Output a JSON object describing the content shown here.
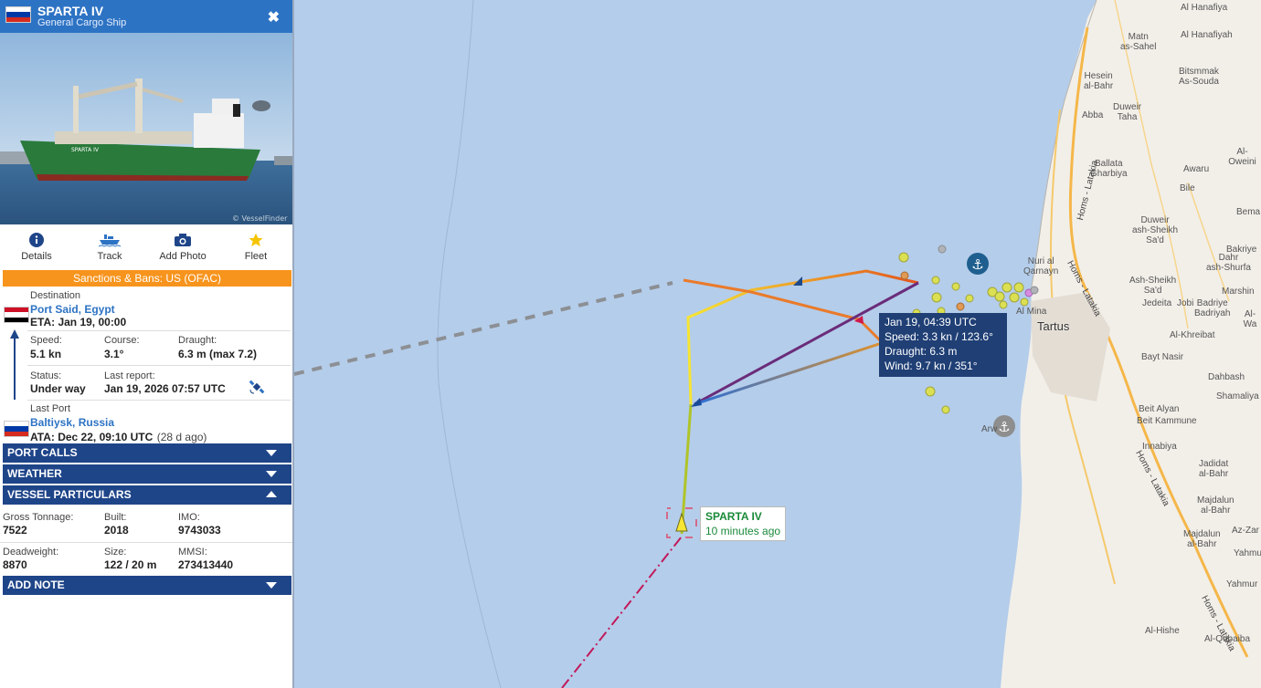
{
  "vessel": {
    "name": "SPARTA IV",
    "type": "General Cargo Ship",
    "flag_colors": [
      "#ffffff",
      "#0039a6",
      "#d52b1e"
    ]
  },
  "photo": {
    "watermark": "© VesselFinder"
  },
  "actions": [
    {
      "label": "Details",
      "icon": "info-icon"
    },
    {
      "label": "Track",
      "icon": "ship-icon"
    },
    {
      "label": "Add Photo",
      "icon": "camera-icon"
    },
    {
      "label": "Fleet",
      "icon": "star-icon"
    }
  ],
  "sanctions": "Sanctions & Bans: US (OFAC)",
  "destination": {
    "label": "Destination",
    "port": "Port Said, Egypt",
    "eta": "ETA: Jan 19, 00:00",
    "flag_colors": [
      "#ce1126",
      "#ffffff",
      "#000000"
    ]
  },
  "voyage": {
    "speed_label": "Speed:",
    "speed": "5.1 kn",
    "course_label": "Course:",
    "course": "3.1°",
    "draught_label": "Draught:",
    "draught": "6.3 m (max 7.2)",
    "status_label": "Status:",
    "status": "Under way",
    "report_label": "Last report:",
    "report": "Jan 19, 2026 07:57 UTC"
  },
  "last_port": {
    "label": "Last Port",
    "port": "Baltiysk, Russia",
    "ata": "ATA: Dec 22, 09:10 UTC",
    "ago": "(28 d ago)"
  },
  "sections": {
    "port_calls": "PORT CALLS",
    "weather": "WEATHER",
    "particulars": "VESSEL PARTICULARS",
    "add_note": "ADD NOTE"
  },
  "particulars": {
    "gt_label": "Gross Tonnage:",
    "gt": "7522",
    "built_label": "Built:",
    "built": "2018",
    "imo_label": "IMO:",
    "imo": "9743033",
    "dwt_label": "Deadweight:",
    "dwt": "8870",
    "size_label": "Size:",
    "size": "122 / 20 m",
    "mmsi_label": "MMSI:",
    "mmsi": "273413440"
  },
  "tooltip": {
    "time": "Jan 19, 04:39 UTC",
    "speed": "Speed: 3.3 kn / 123.6°",
    "draught": "Draught: 6.3 m",
    "wind": "Wind: 9.7 kn / 351°"
  },
  "ship_label": {
    "name": "SPARTA IV",
    "ago": "10 minutes ago"
  },
  "map": {
    "city": "Tartus",
    "places": [
      "Al Hanafiya",
      "Al Hanafiyah",
      "Matn\nas-Sahel",
      "Hesein\nal-Bahr",
      "Bitsmmak\nAs-Souda",
      "Abba",
      "Duweir\nTaha",
      "Al-Oweini",
      "Ballata\nGharbiya",
      "Awaru",
      "Bile",
      "Duweir\nash-Sheikh\nSa'd",
      "Bema",
      "Bakriye",
      "Dahr\nash-Shurfa",
      "Nuri al\nQarnayn",
      "Ash-Sheikh\nSa'd",
      "Marshin",
      "Jedeita",
      "Jobi",
      "Badriye\nBadriyah",
      "Al-Wa",
      "Al Mina",
      "Al-Khreibat",
      "Bayt Nasir",
      "Dahbash",
      "Shamaliya",
      "Beit Alyan",
      "Beit Kammune",
      "Innabiya",
      "Jadidat\nal-Bahr",
      "Majdalun\nal-Bahr",
      "Az-Zar",
      "Majdalun\nal-Bahr",
      "Yahmu",
      "Yahmur",
      "Al-Hishe",
      "Al-Qobaiba",
      "Arw"
    ],
    "roads": [
      "Homs - Latakia",
      "Homs - Latakia",
      "Homs - Latakia",
      "Homs - Latakia"
    ]
  }
}
